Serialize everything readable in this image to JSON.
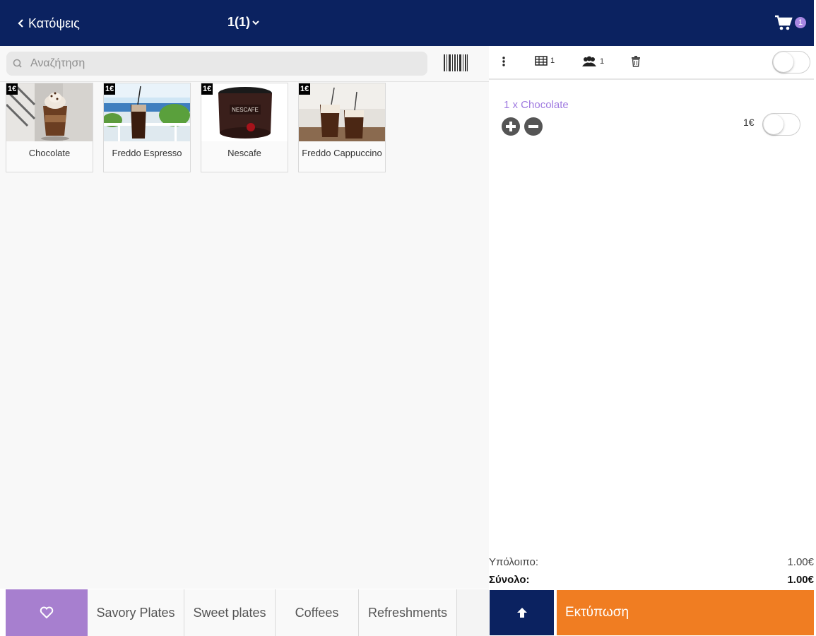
{
  "header": {
    "back_label": "Κατόψεις",
    "table_label": "1(1)",
    "cart_count": "1",
    "bg_color": "#0b2260"
  },
  "search": {
    "placeholder": "Αναζήτηση"
  },
  "products": [
    {
      "name": "Chocolate",
      "price": "1€"
    },
    {
      "name": "Freddo Espresso",
      "price": "1€"
    },
    {
      "name": "Nescafe",
      "price": "1€"
    },
    {
      "name": "Freddo Cappuccino",
      "price": "1€"
    }
  ],
  "toolbar": {
    "table_count": "1",
    "guests_count": "1"
  },
  "order": {
    "items": [
      {
        "label": "1 x Chocolate",
        "price": "1€"
      }
    ],
    "subtotal_label": "Υπόλοιπο:",
    "subtotal_value": "1.00€",
    "total_label": "Σύνολο:",
    "total_value": "1.00€"
  },
  "categories": [
    "Savory Plates",
    "Sweet plates",
    "Coffees",
    "Refreshments"
  ],
  "actions": {
    "print_label": "Εκτύπωση"
  },
  "colors": {
    "accent_purple": "#a77fcf",
    "print_orange": "#f07d22",
    "navy": "#0b2260"
  }
}
